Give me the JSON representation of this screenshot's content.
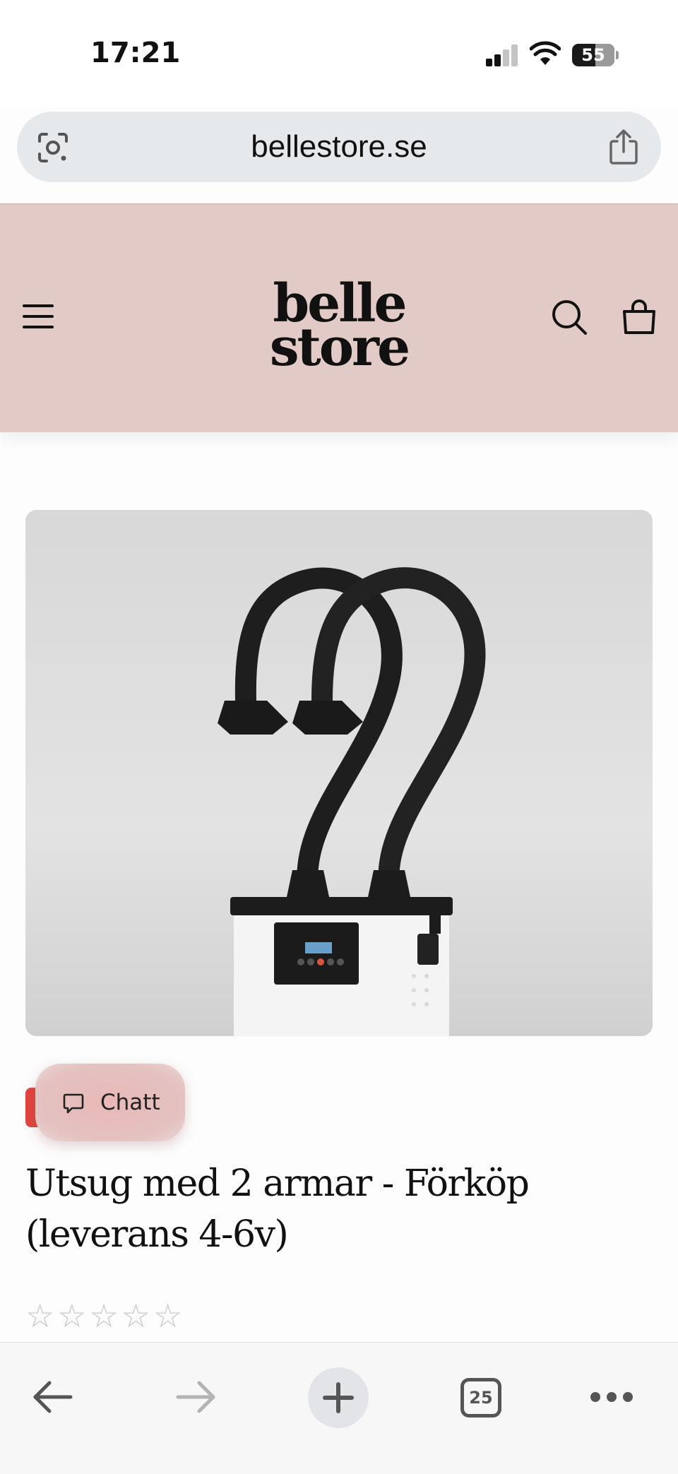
{
  "status_bar": {
    "time": "17:21",
    "battery": "55",
    "battery_level_percent": 55,
    "icons": [
      "cellular-signal-icon",
      "wifi-icon",
      "battery-icon"
    ]
  },
  "browser": {
    "url": "bellestore.se",
    "tab_count": "25",
    "icons": [
      "google-lens-icon",
      "share-icon",
      "back-arrow-icon",
      "forward-arrow-icon",
      "new-tab-plus-icon",
      "tabs-icon",
      "more-icon"
    ]
  },
  "site_header": {
    "logo_line1": "belle",
    "logo_line2": "store",
    "background_color": "#e2cbc6",
    "icons": [
      "hamburger-menu-icon",
      "search-icon",
      "shopping-bag-icon"
    ]
  },
  "product": {
    "title": "Utsug med 2 armar - Förköp (leverans 4-6v)",
    "rating_stars": [
      "☆",
      "☆",
      "☆",
      "☆",
      "☆"
    ],
    "rating_value": 0,
    "rating_max": 5
  },
  "chat": {
    "label": "Chatt",
    "accent_color": "#e0453f"
  }
}
